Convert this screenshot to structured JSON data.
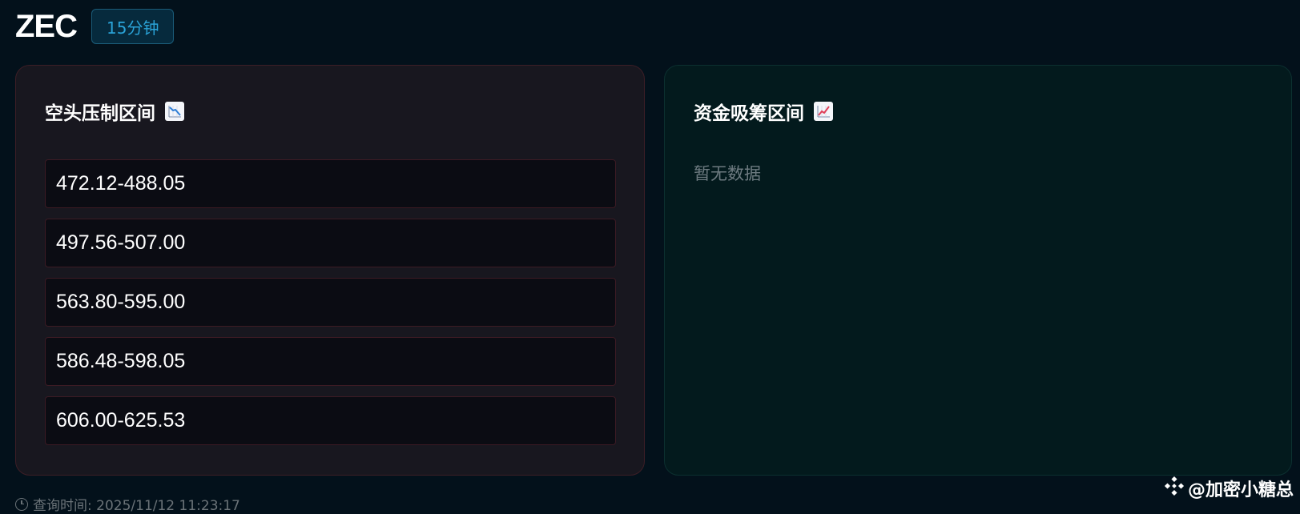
{
  "header": {
    "symbol": "ZEC",
    "timeframe": "15分钟"
  },
  "bear_card": {
    "title": "空头压制区间",
    "icon": "chart-decreasing-icon",
    "accent": "#e0405a",
    "zones": [
      "472.12-488.05",
      "497.56-507.00",
      "563.80-595.00",
      "586.48-598.05",
      "606.00-625.53"
    ]
  },
  "bull_card": {
    "title": "资金吸筹区间",
    "icon": "chart-increasing-icon",
    "accent": "#e0405a",
    "empty_text": "暂无数据"
  },
  "footer": {
    "query_time": "查询时间: 2025/11/12 11:23:17"
  },
  "watermark": {
    "text": "@加密小糖总",
    "icon": "binance-logo-icon"
  }
}
